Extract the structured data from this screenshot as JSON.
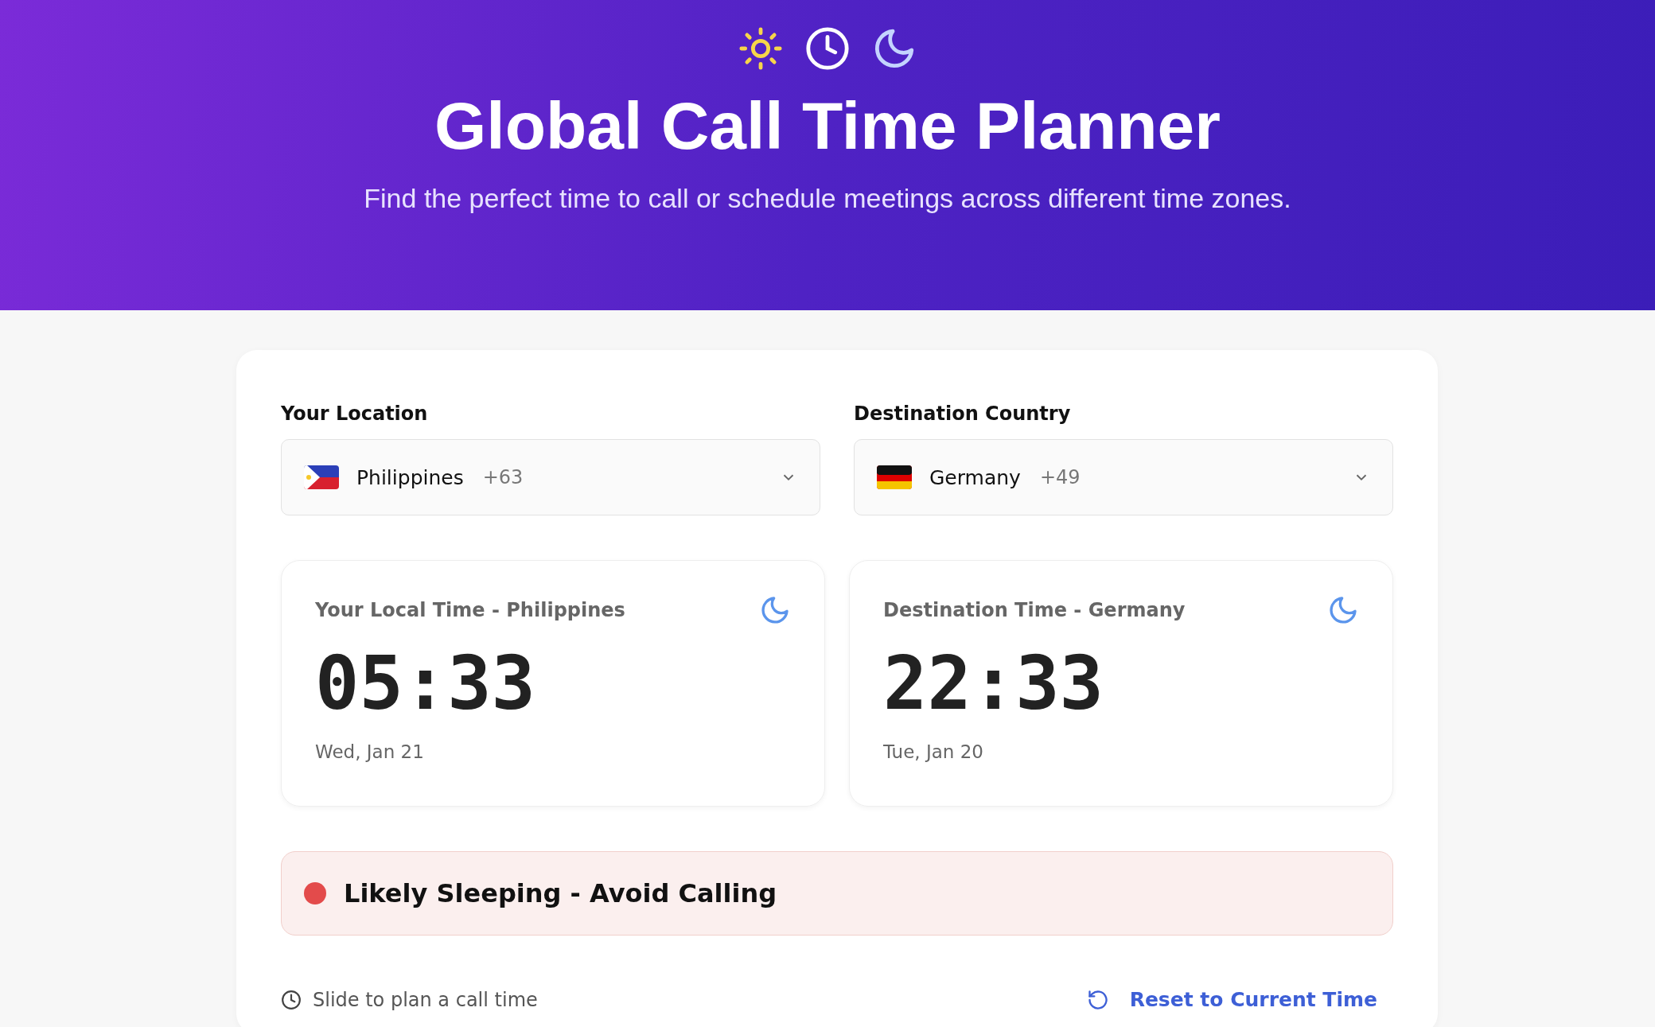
{
  "header": {
    "title": "Global Call Time Planner",
    "subtitle": "Find the perfect time to call or schedule meetings across different time zones."
  },
  "locations": [
    {
      "label": "Your Location",
      "country": "Philippines",
      "code": "+63",
      "kind": "ph"
    },
    {
      "label": "Destination Country",
      "country": "Germany",
      "code": "+49",
      "kind": "de"
    }
  ],
  "time_cards": [
    {
      "title": "Your Local Time - Philippines",
      "time": "05:33",
      "date": "Wed, Jan 21",
      "kind": "night"
    },
    {
      "title": "Destination Time - Germany",
      "time": "22:33",
      "date": "Tue, Jan 20",
      "kind": "night"
    }
  ],
  "status": {
    "kind": "sleeping",
    "text": "Likely Sleeping - Avoid Calling"
  },
  "slider_hint": "Slide to plan a call time",
  "reset_button": "Reset to Current Time"
}
